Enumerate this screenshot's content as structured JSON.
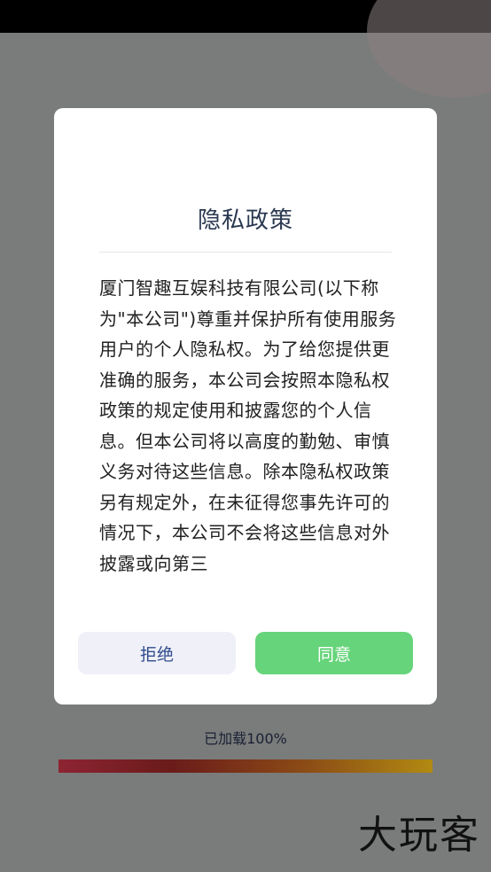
{
  "dialog": {
    "title": "隐私政策",
    "body": "厦门智趣互娱科技有限公司(以下称为\"本公司\")尊重并保护所有使用服务用户的个人隐私权。为了给您提供更准确的服务，本公司会按照本隐私权政策的规定使用和披露您的个人信息。但本公司将以高度的勤勉、审慎义务对待这些信息。除本隐私权政策另有规定外，在未征得您事先许可的情况下，本公司不会将这些信息对外披露或向第三",
    "reject_label": "拒绝",
    "agree_label": "同意"
  },
  "loading": {
    "text": "已加载100%",
    "progress": 1.0
  },
  "watermark": "大玩客",
  "colors": {
    "agree": "#66d47a",
    "reject_bg": "#eff0f8",
    "title": "#2a3850"
  }
}
